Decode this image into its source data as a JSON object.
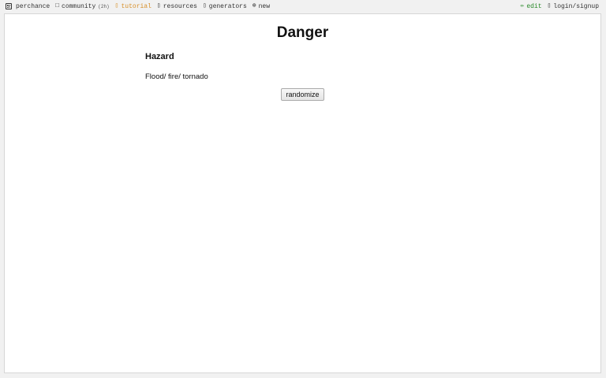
{
  "nav": {
    "brand": "perchance",
    "community": {
      "label": "community",
      "count": "(2h)"
    },
    "tutorial": "tutorial",
    "resources": "resources",
    "generators": "generators",
    "new": "new",
    "edit": "edit",
    "login": "login/signup"
  },
  "icons": {
    "brand": "dice-icon",
    "community": "chat-icon",
    "tutorial": "book-icon",
    "resources": "folder-icon",
    "generators": "list-icon",
    "new": "plus-circle-icon",
    "edit": "pencil-icon",
    "login": "user-icon"
  },
  "colors": {
    "tutorial": "#d7902b",
    "edit": "#2a8a2a",
    "background": "#f1f1f1"
  },
  "page": {
    "title": "Danger",
    "subtitle": "Hazard",
    "result": "Flood/ fire/ tornado",
    "button": "randomize"
  }
}
